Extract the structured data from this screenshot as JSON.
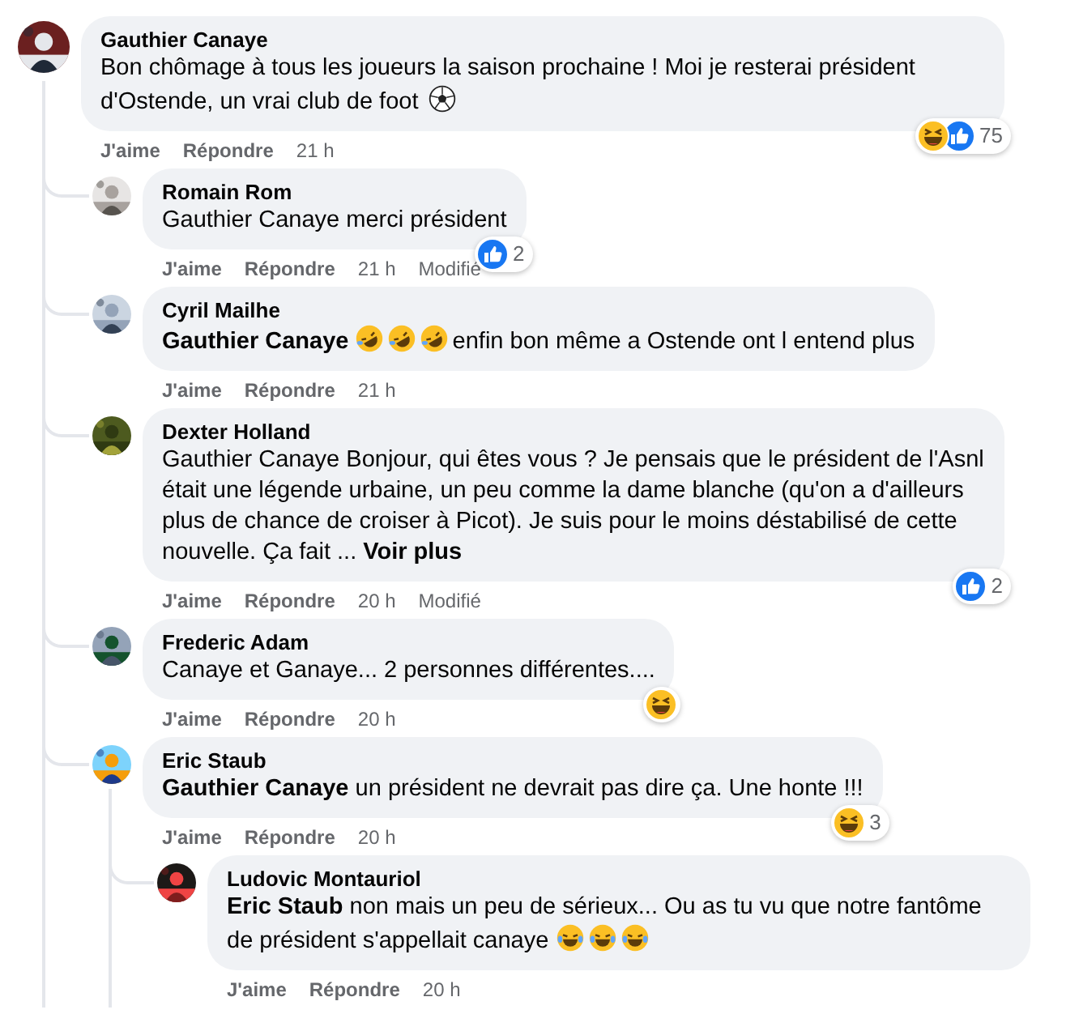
{
  "comments": [
    {
      "author": "Gauthier Canaye",
      "body": [
        {
          "kind": "text",
          "text": "Bon chômage à tous les joueurs la saison prochaine ! Moi je resterai président d'Ostende, un vrai club de foot"
        },
        {
          "kind": "ball_emoji"
        }
      ],
      "reactions": [
        {
          "kind": "haha"
        },
        {
          "kind": "like"
        }
      ],
      "reaction_count": "75",
      "actions": [
        "J'aime",
        "Répondre"
      ],
      "time": "21 h",
      "replies": [
        {
          "author": "Romain Rom",
          "body": [
            {
              "kind": "text",
              "text": "Gauthier Canaye merci président"
            }
          ],
          "reactions": [
            {
              "kind": "like"
            }
          ],
          "reaction_count": "2",
          "actions": [
            "J'aime",
            "Répondre"
          ],
          "time": "21 h",
          "edited": "Modifié"
        },
        {
          "author": "Cyril Mailhe",
          "body": [
            {
              "kind": "mention",
              "text": "Gauthier Canaye"
            },
            {
              "kind": "rofl_emoji"
            },
            {
              "kind": "rofl_emoji"
            },
            {
              "kind": "rofl_emoji"
            },
            {
              "kind": "text",
              "text": "enfin bon même a Ostende ont l entend plus"
            }
          ],
          "actions": [
            "J'aime",
            "Répondre"
          ],
          "time": "21 h"
        },
        {
          "author": "Dexter Holland",
          "body": [
            {
              "kind": "text",
              "text": "Gauthier Canaye Bonjour, qui êtes vous ? Je pensais que le président de l'Asnl était une légende urbaine, un peu comme la dame blanche (qu'on a d'ailleurs plus de chance de croiser à Picot). Je suis pour le moins déstabilisé de cette nouvelle. Ça fait ..."
            },
            {
              "kind": "more",
              "text": "Voir plus"
            }
          ],
          "reactions": [
            {
              "kind": "like"
            }
          ],
          "reaction_count": "2",
          "actions": [
            "J'aime",
            "Répondre"
          ],
          "time": "20 h",
          "edited": "Modifié"
        },
        {
          "author": "Frederic Adam",
          "body": [
            {
              "kind": "text",
              "text": "Canaye et Ganaye... 2 personnes différentes...."
            }
          ],
          "reactions": [
            {
              "kind": "haha"
            }
          ],
          "actions": [
            "J'aime",
            "Répondre"
          ],
          "time": "20 h"
        },
        {
          "author": "Eric Staub",
          "body": [
            {
              "kind": "mention",
              "text": "Gauthier Canaye"
            },
            {
              "kind": "text",
              "text": "un président ne devrait pas dire ça. Une honte !!!"
            }
          ],
          "reactions": [
            {
              "kind": "haha"
            }
          ],
          "reaction_count": "3",
          "actions": [
            "J'aime",
            "Répondre"
          ],
          "time": "20 h",
          "replies": [
            {
              "author": "Ludovic Montauriol",
              "body": [
                {
                  "kind": "mention",
                  "text": "Eric Staub"
                },
                {
                  "kind": "text",
                  "text": "non mais un peu de sérieux... Ou as tu vu que notre fantôme de président s'appellait canaye"
                },
                {
                  "kind": "tears_emoji"
                },
                {
                  "kind": "tears_emoji"
                },
                {
                  "kind": "tears_emoji"
                }
              ],
              "actions": [
                "J'aime",
                "Répondre"
              ],
              "time": "20 h"
            }
          ]
        }
      ]
    }
  ]
}
